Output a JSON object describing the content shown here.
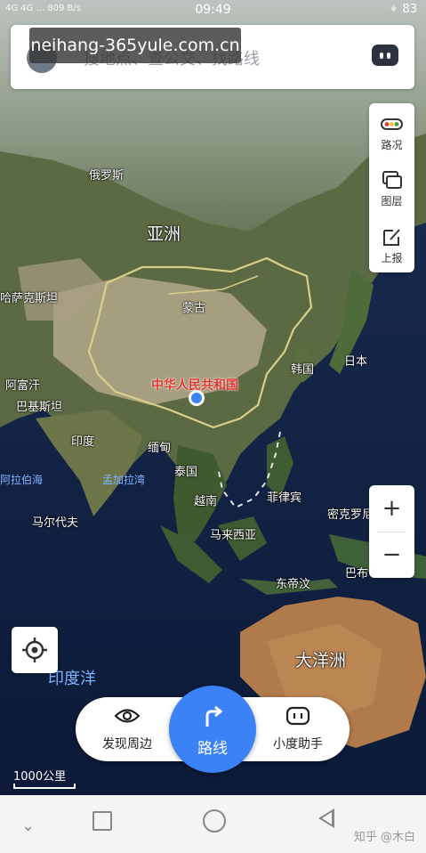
{
  "status_bar": {
    "left": "4G 4G ... 809 B/s",
    "time": "09:49",
    "battery": "83"
  },
  "search": {
    "placeholder": "搜地点、查公交、找路线"
  },
  "watermark": "neihang-365yule.com.cn",
  "right_panel": {
    "items": [
      {
        "label": "路况",
        "icon": "traffic-icon"
      },
      {
        "label": "图层",
        "icon": "layers-icon"
      },
      {
        "label": "上报",
        "icon": "report-icon"
      }
    ]
  },
  "zoom": {
    "in": "+",
    "out": "−"
  },
  "map_labels": {
    "russia": "俄罗斯",
    "asia": "亚洲",
    "kazakhstan": "哈萨克斯坦",
    "mongolia": "蒙古",
    "china": "中华人民共和国",
    "korea": "韩国",
    "japan": "日本",
    "afghanistan": "阿富汗",
    "pakistan": "巴基斯坦",
    "india": "印度",
    "myanmar": "缅甸",
    "thailand": "泰国",
    "vietnam": "越南",
    "philippines": "菲律宾",
    "malaysia": "马来西亚",
    "micronesia": "密克罗尼",
    "papua": "巴布",
    "east_timor": "东帝汶",
    "maldives": "马尔代夫",
    "arabian_sea": "阿拉伯海",
    "bay_of_bengal": "孟加拉湾",
    "indian_ocean": "印度洋",
    "oceania": "大洋洲"
  },
  "bottom_bar": {
    "discover": "发现周边",
    "route": "路线",
    "assistant": "小度助手"
  },
  "scale": "1000公里",
  "credit": "知乎 @木白",
  "colors": {
    "accent": "#3b82f6",
    "border_line": "#d8cf8a",
    "location_dot": "#3b82f6"
  }
}
